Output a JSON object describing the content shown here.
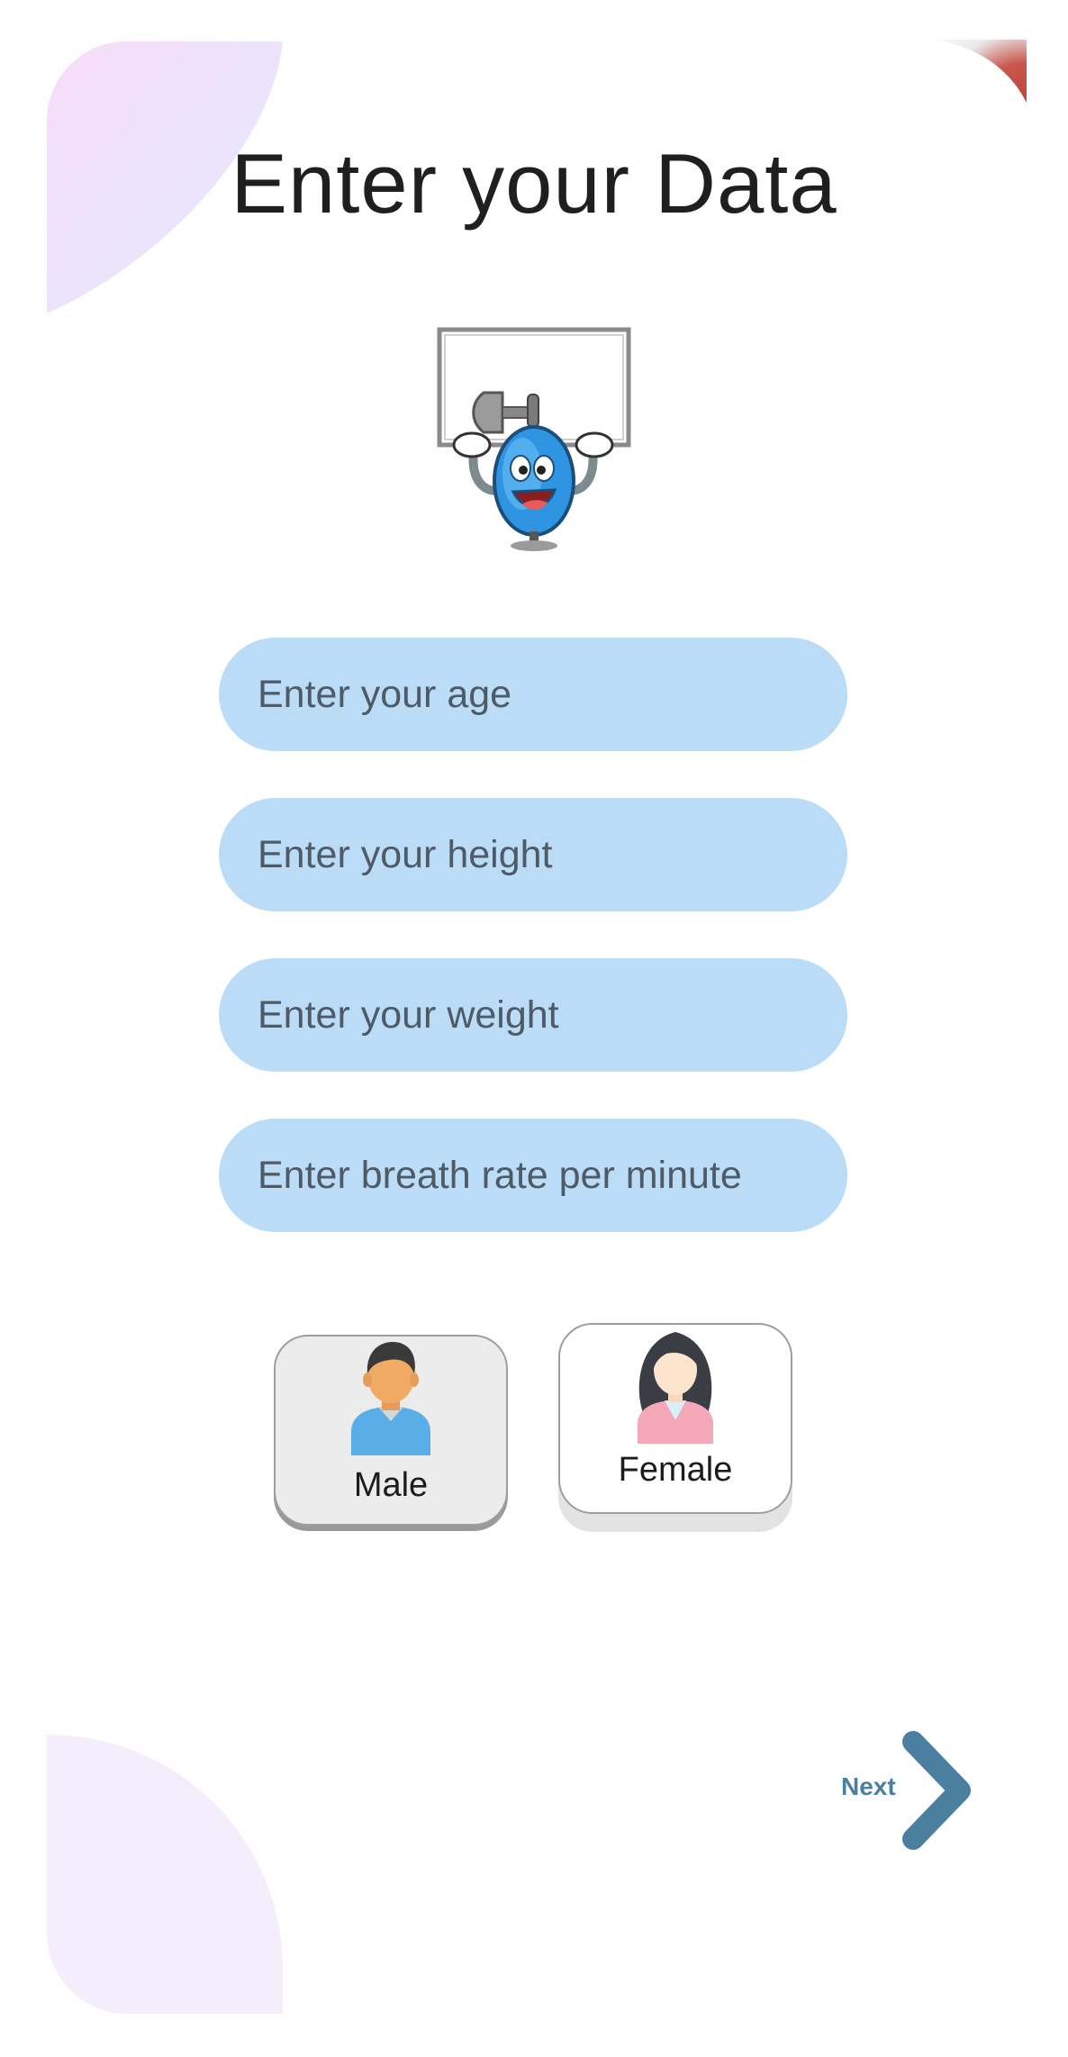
{
  "page": {
    "title": "Enter your Data"
  },
  "form": {
    "age_placeholder": "Enter your age",
    "height_placeholder": "Enter your height",
    "weight_placeholder": "Enter your weight",
    "breath_placeholder": "Enter breath rate per minute"
  },
  "gender": {
    "male_label": "Male",
    "female_label": "Female",
    "selected": "Male"
  },
  "navigation": {
    "next_label": "Next"
  },
  "icons": {
    "mascot": "inhaler-mascot-icon",
    "male": "male-avatar-icon",
    "female": "female-avatar-icon",
    "next": "chevron-right-icon"
  },
  "colors": {
    "field_background": "#bbdcf7",
    "accent": "#4a7fa0",
    "title": "#1f1f1f"
  }
}
